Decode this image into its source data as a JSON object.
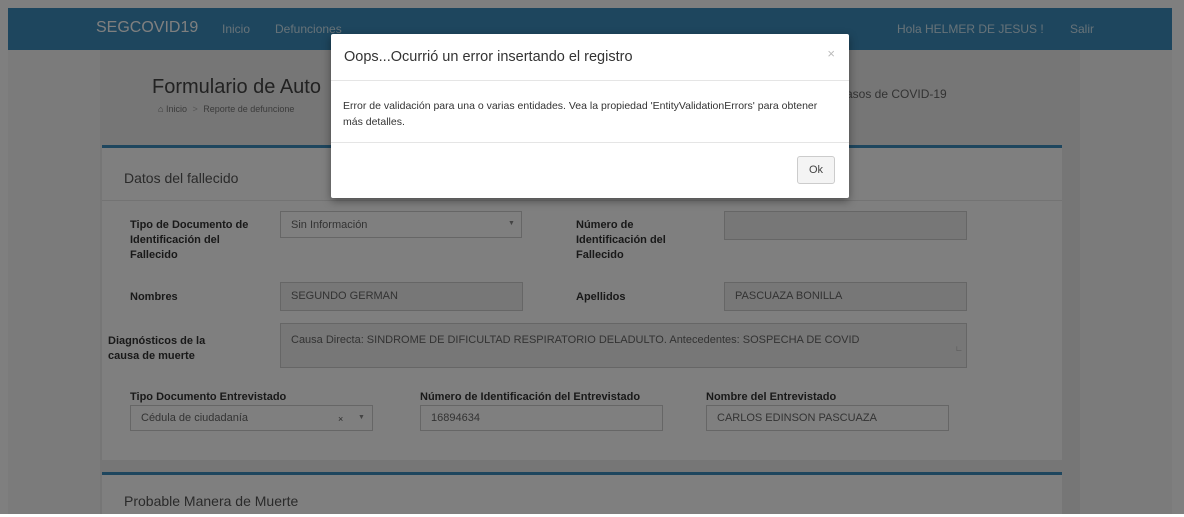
{
  "navbar": {
    "brand": "SEGCOVID19",
    "links": [
      "Inicio",
      "Defunciones"
    ],
    "greeting": "Hola HELMER DE JESUS !",
    "logout": "Salir"
  },
  "page": {
    "title": "Formulario de Auto",
    "title_tail": "asos de COVID-19",
    "breadcrumb": [
      "Inicio",
      "Reporte de defuncione"
    ]
  },
  "deceased": {
    "title": "Datos del fallecido",
    "doc_type_label": "Tipo de Documento de Identificación del Fallecido",
    "doc_type_value": "Sin Información",
    "doc_number_label": "Número de Identificación del Fallecido",
    "doc_number_value": "",
    "names_label": "Nombres",
    "names_value": "SEGUNDO GERMAN",
    "surnames_label": "Apellidos",
    "surnames_value": "PASCUAZA BONILLA",
    "diagnosis_label": "Diagnósticos de la causa de muerte",
    "diagnosis_value": "Causa Directa: SINDROME DE DIFICULTAD RESPIRATORIO DELADULTO. Antecedentes: SOSPECHA DE COVID",
    "interviewee_doc_type_label": "Tipo Documento Entrevistado",
    "interviewee_doc_type_value": "Cédula de ciudadanía",
    "interviewee_doc_number_label": "Número de Identificación del Entrevistado",
    "interviewee_doc_number_value": "16894634",
    "interviewee_name_label": "Nombre del Entrevistado",
    "interviewee_name_value": "CARLOS EDINSON PASCUAZA"
  },
  "manner": {
    "title": "Probable Manera de Muerte"
  },
  "modal": {
    "title": "Oops...Ocurrió un error insertando el registro",
    "close": "×",
    "body": "Error de validación para una o varias entidades. Vea la propiedad 'EntityValidationErrors' para obtener más detalles.",
    "ok": "Ok"
  },
  "icons": {
    "home": "home-icon",
    "dropdown": "caret-down-icon",
    "clear": "clear-icon",
    "close": "close-icon"
  },
  "colors": {
    "navbar": "#3c8dbc",
    "panel_accent": "#3c8dbc"
  }
}
